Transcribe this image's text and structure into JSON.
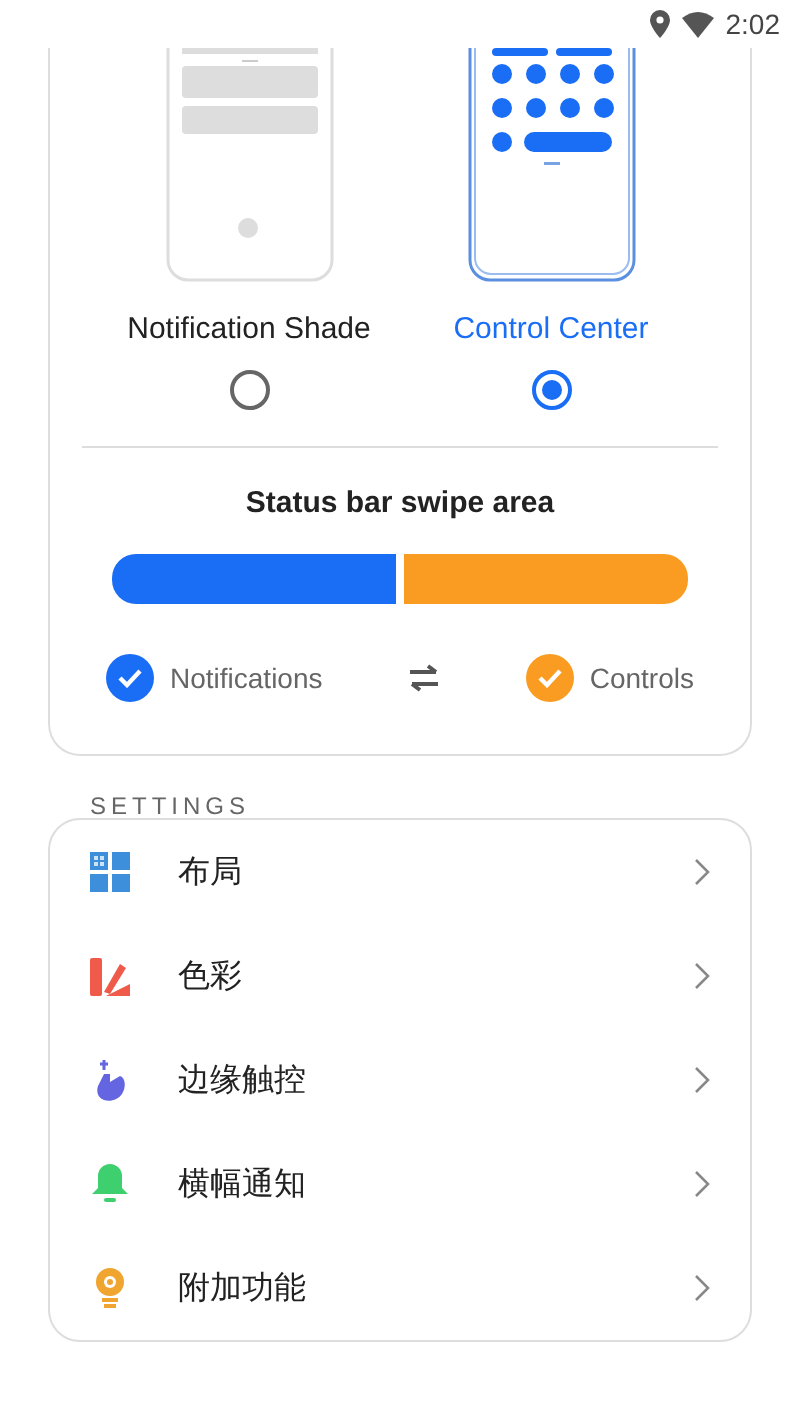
{
  "status_bar": {
    "time": "2:02"
  },
  "modes": [
    {
      "label": "Notification Shade",
      "kind": "shade",
      "selected": false
    },
    {
      "label": "Control Center",
      "kind": "control",
      "selected": true
    }
  ],
  "swipe_area": {
    "title": "Status bar swipe area",
    "level": 0.5,
    "left": {
      "label": "Notifications",
      "checked": true
    },
    "right": {
      "label": "Controls",
      "checked": true
    }
  },
  "settings_header": "SETTINGS",
  "settings": [
    {
      "label": "布局",
      "kind": "layout"
    },
    {
      "label": "色彩",
      "kind": "color"
    },
    {
      "label": "边缘触控",
      "kind": "touch"
    },
    {
      "label": "横幅通知",
      "kind": "bell"
    },
    {
      "label": "附加功能",
      "kind": "bulb"
    }
  ]
}
